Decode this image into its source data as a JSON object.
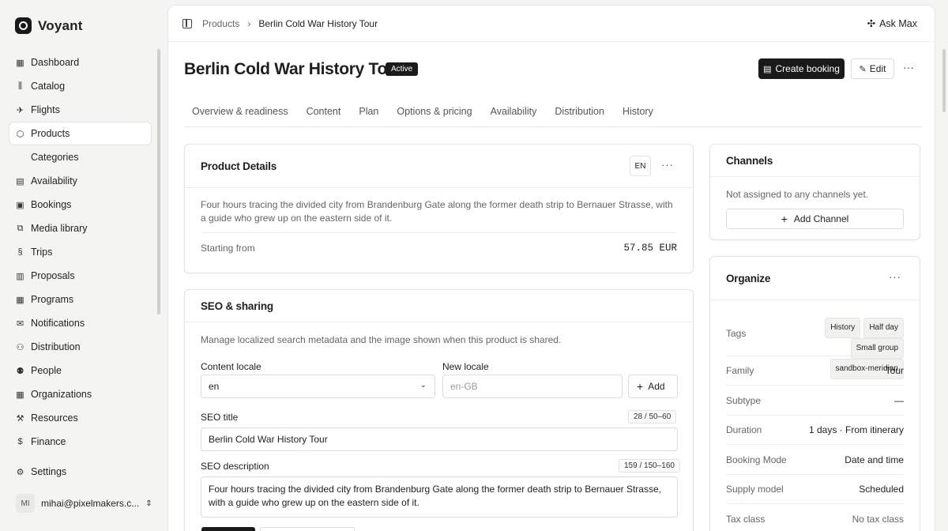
{
  "app": {
    "name": "Voyant"
  },
  "sidebar": {
    "items": [
      {
        "label": "Dashboard",
        "icon": "dashboard-icon"
      },
      {
        "label": "Catalog",
        "icon": "catalog-icon"
      },
      {
        "label": "Flights",
        "icon": "plane-icon"
      },
      {
        "label": "Products",
        "icon": "box-icon",
        "active": true
      },
      {
        "label": "Categories",
        "icon": "",
        "sub": true
      },
      {
        "label": "Availability",
        "icon": "calendar-icon"
      },
      {
        "label": "Bookings",
        "icon": "calendar-check-icon"
      },
      {
        "label": "Media library",
        "icon": "image-icon"
      },
      {
        "label": "Trips",
        "icon": "route-icon"
      },
      {
        "label": "Proposals",
        "icon": "document-icon"
      },
      {
        "label": "Programs",
        "icon": "calendar-grid-icon"
      },
      {
        "label": "Notifications",
        "icon": "mail-icon"
      },
      {
        "label": "Distribution",
        "icon": "network-icon"
      },
      {
        "label": "People",
        "icon": "people-icon"
      },
      {
        "label": "Organizations",
        "icon": "building-icon"
      },
      {
        "label": "Resources",
        "icon": "wrench-icon"
      },
      {
        "label": "Finance",
        "icon": "dollar-icon"
      }
    ],
    "settings": "Settings",
    "user": {
      "initials": "MI",
      "email": "mihai@pixelmakers.c..."
    }
  },
  "topbar": {
    "breadcrumb": [
      "Products",
      "Berlin Cold War History Tour"
    ],
    "ask": "Ask Max"
  },
  "header": {
    "title": "Berlin Cold War History Tour",
    "status": "Active",
    "create_booking": "Create booking",
    "edit": "Edit"
  },
  "tabs": [
    "Overview & readiness",
    "Content",
    "Plan",
    "Options & pricing",
    "Availability",
    "Distribution",
    "History"
  ],
  "product_details": {
    "title": "Product Details",
    "locale": "EN",
    "description": "Four hours tracing the divided city from Brandenburg Gate along the former death strip to Bernauer Strasse, with a guide who grew up on the eastern side of it.",
    "starting_label": "Starting from",
    "starting_value": "57.85 EUR"
  },
  "seo": {
    "title": "SEO & sharing",
    "intro": "Manage localized search metadata and the image shown when this product is shared.",
    "content_locale_label": "Content locale",
    "content_locale_value": "en",
    "new_locale_label": "New locale",
    "new_locale_placeholder": "en-GB",
    "add": "Add",
    "seo_title_label": "SEO title",
    "seo_title_counter": "28 / 50–60",
    "seo_title_value": "Berlin Cold War History Tour",
    "seo_desc_label": "SEO description",
    "seo_desc_counter": "159 / 150–160",
    "seo_desc_value": "Four hours tracing the divided city from Brandenburg Gate along the former death strip to Bernauer Strasse, with a guide who grew up on the eastern side of it."
  },
  "channels": {
    "title": "Channels",
    "empty": "Not assigned to any channels yet.",
    "add": "Add Channel"
  },
  "organize": {
    "title": "Organize",
    "tags_label": "Tags",
    "tags": [
      "History",
      "Half day",
      "Small group",
      "sandbox-meridian"
    ],
    "rows": [
      {
        "k": "Family",
        "v": "Tour"
      },
      {
        "k": "Subtype",
        "v": "—"
      },
      {
        "k": "Duration",
        "v": "1 days · From itinerary"
      },
      {
        "k": "Booking Mode",
        "v": "Date and time"
      },
      {
        "k": "Supply model",
        "v": "Scheduled"
      },
      {
        "k": "Tax class",
        "v": "No tax class"
      }
    ]
  }
}
